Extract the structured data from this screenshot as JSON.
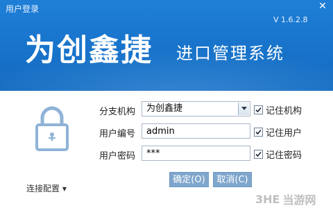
{
  "window": {
    "title": "用户登录",
    "close_glyph": "✕",
    "version": "V 1.6.2.8"
  },
  "brand": {
    "name": "为创鑫捷",
    "subtitle": "进口管理系统"
  },
  "form": {
    "branch_label": "分支机构",
    "branch_value": "为创鑫捷",
    "user_label": "用户编号",
    "user_value": "admin",
    "password_label": "用户密码",
    "password_value": "***",
    "remember_branch": "记住机构",
    "remember_user": "记住用户",
    "remember_password": "记住密码",
    "remember_branch_checked": true,
    "remember_user_checked": true,
    "remember_password_checked": true
  },
  "buttons": {
    "ok": "确定(O)",
    "cancel": "取消(C)"
  },
  "config_link": "连接配置",
  "config_arrow": "▼",
  "watermark": {
    "logo": "3HE",
    "text": "当游网"
  },
  "colors": {
    "banner": "#1a77cf",
    "button": "#7fa6cc",
    "lock": "#8fb3d6"
  },
  "icons": {
    "lock": "lock-icon",
    "close": "close-icon",
    "dropdown": "chevron-down-icon",
    "check": "checkmark-icon"
  }
}
